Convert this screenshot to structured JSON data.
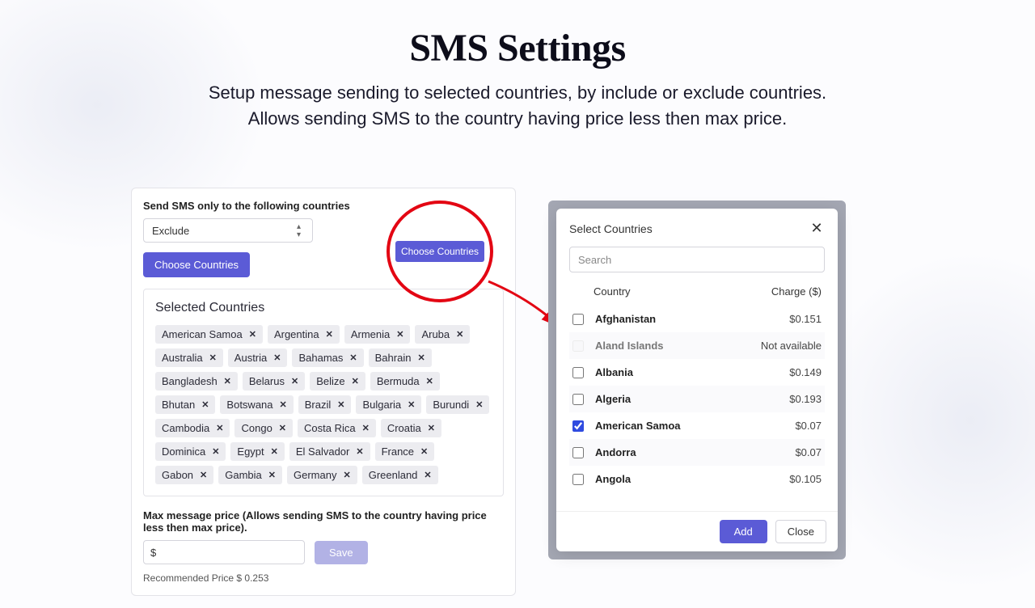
{
  "page": {
    "title": "SMS Settings",
    "subtitle": "Setup message sending to selected countries, by include or exclude countries. Allows sending SMS to the country having price less then max price."
  },
  "left": {
    "section_label": "Send SMS only to the following countries",
    "mode_value": "Exclude",
    "choose_btn": "Choose Countries",
    "selected_title": "Selected Countries",
    "chips": [
      "American Samoa",
      "Argentina",
      "Armenia",
      "Aruba",
      "Australia",
      "Austria",
      "Bahamas",
      "Bahrain",
      "Bangladesh",
      "Belarus",
      "Belize",
      "Bermuda",
      "Bhutan",
      "Botswana",
      "Brazil",
      "Bulgaria",
      "Burundi",
      "Cambodia",
      "Congo",
      "Costa Rica",
      "Croatia",
      "Dominica",
      "Egypt",
      "El Salvador",
      "France",
      "Gabon",
      "Gambia",
      "Germany",
      "Greenland"
    ],
    "max_label": "Max message price (Allows sending SMS to the country having price less then max price).",
    "max_value": "$",
    "save_btn": "Save",
    "recommended": "Recommended Price $ 0.253"
  },
  "circle_btn": "Choose Countries",
  "modal": {
    "title": "Select Countries",
    "search_placeholder": "Search",
    "col_country": "Country",
    "col_charge": "Charge ($)",
    "rows": [
      {
        "name": "Afghanistan",
        "charge": "$0.151",
        "checked": false,
        "disabled": false
      },
      {
        "name": "Aland Islands",
        "charge": "Not available",
        "checked": false,
        "disabled": true
      },
      {
        "name": "Albania",
        "charge": "$0.149",
        "checked": false,
        "disabled": false
      },
      {
        "name": "Algeria",
        "charge": "$0.193",
        "checked": false,
        "disabled": false
      },
      {
        "name": "American Samoa",
        "charge": "$0.07",
        "checked": true,
        "disabled": false
      },
      {
        "name": "Andorra",
        "charge": "$0.07",
        "checked": false,
        "disabled": false
      },
      {
        "name": "Angola",
        "charge": "$0.105",
        "checked": false,
        "disabled": false
      }
    ],
    "add_btn": "Add",
    "close_btn": "Close"
  }
}
